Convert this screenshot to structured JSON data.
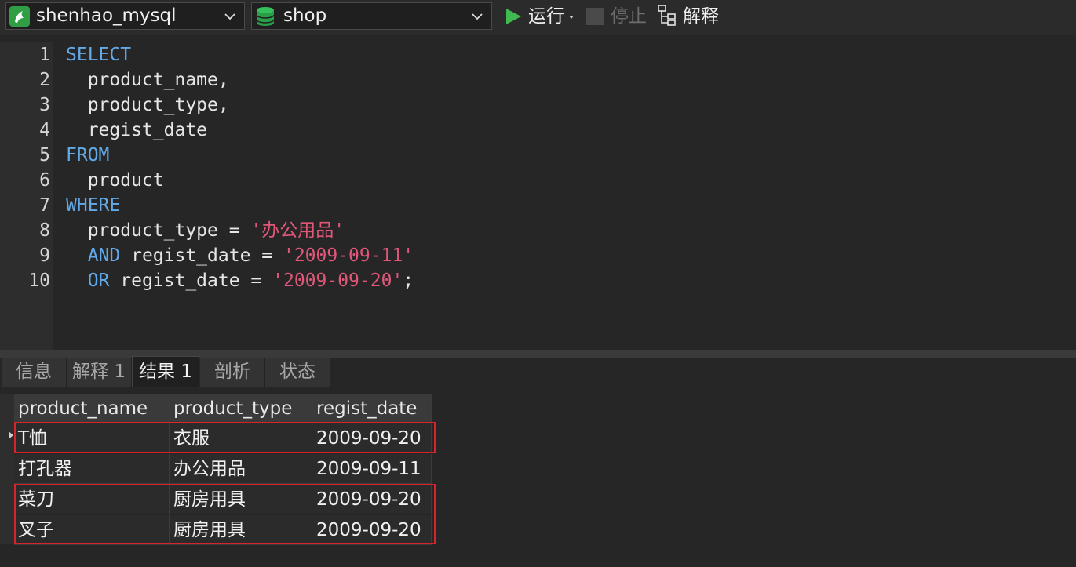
{
  "toolbar": {
    "connection": "shenhao_mysql",
    "database": "shop",
    "run_label": "运行",
    "stop_label": "停止",
    "explain_label": "解释"
  },
  "editor": {
    "line_numbers": [
      "1",
      "2",
      "3",
      "4",
      "5",
      "6",
      "7",
      "8",
      "9",
      "10"
    ],
    "lines": [
      [
        {
          "t": "SELECT",
          "c": "kw"
        }
      ],
      [
        {
          "t": "  product_name,",
          "c": ""
        }
      ],
      [
        {
          "t": "  product_type,",
          "c": ""
        }
      ],
      [
        {
          "t": "  regist_date",
          "c": ""
        }
      ],
      [
        {
          "t": "FROM",
          "c": "kw"
        }
      ],
      [
        {
          "t": "  product",
          "c": ""
        }
      ],
      [
        {
          "t": "WHERE",
          "c": "kw"
        }
      ],
      [
        {
          "t": "  product_type = ",
          "c": ""
        },
        {
          "t": "'办公用品'",
          "c": "str"
        }
      ],
      [
        {
          "t": "  ",
          "c": ""
        },
        {
          "t": "AND",
          "c": "kw"
        },
        {
          "t": " regist_date = ",
          "c": ""
        },
        {
          "t": "'2009-09-11'",
          "c": "str"
        }
      ],
      [
        {
          "t": "  ",
          "c": ""
        },
        {
          "t": "OR",
          "c": "kw"
        },
        {
          "t": " regist_date = ",
          "c": ""
        },
        {
          "t": "'2009-09-20'",
          "c": "str"
        },
        {
          "t": ";",
          "c": ""
        }
      ]
    ]
  },
  "tabs": [
    {
      "label": "信息"
    },
    {
      "label": "解释 1"
    },
    {
      "label": "结果 1"
    },
    {
      "label": "剖析"
    },
    {
      "label": "状态"
    }
  ],
  "active_tab": "结果 1",
  "results": {
    "columns": [
      "product_name",
      "product_type",
      "regist_date"
    ],
    "rows": [
      [
        "T恤",
        "衣服",
        "2009-09-20"
      ],
      [
        "打孔器",
        "办公用品",
        "2009-09-11"
      ],
      [
        "菜刀",
        "厨房用具",
        "2009-09-20"
      ],
      [
        "叉子",
        "厨房用具",
        "2009-09-20"
      ]
    ]
  },
  "colors": {
    "keyword": "#63a9e8",
    "string": "#e0577a",
    "highlight": "#d8232a",
    "run_icon": "#3fb950"
  }
}
